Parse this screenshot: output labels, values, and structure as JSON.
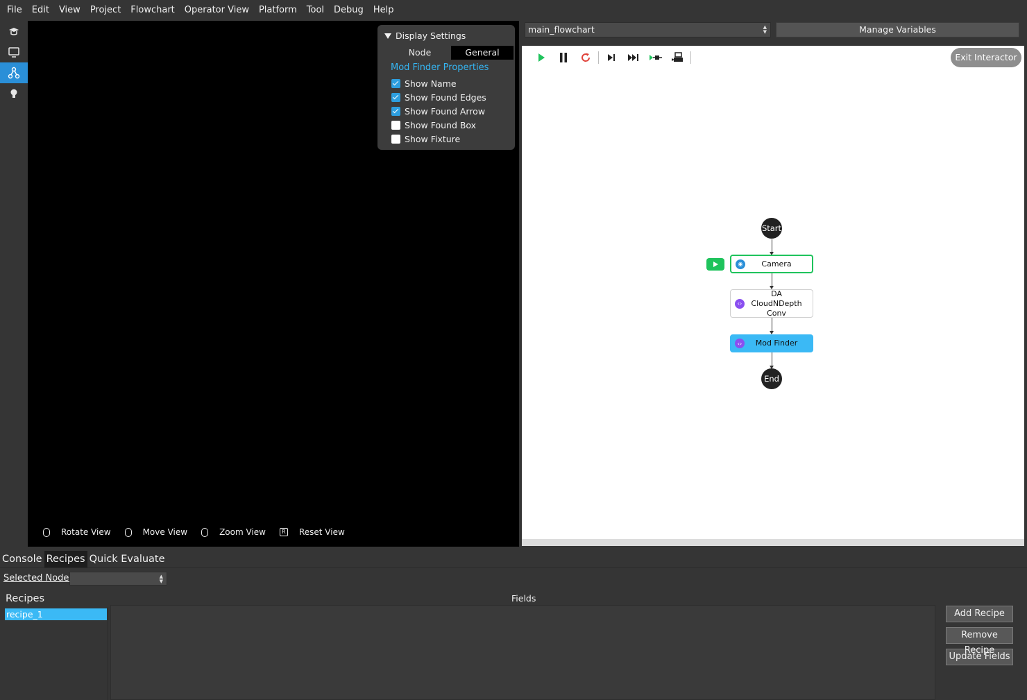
{
  "menu": [
    "File",
    "Edit",
    "View",
    "Project",
    "Flowchart",
    "Operator View",
    "Platform",
    "Tool",
    "Debug",
    "Help"
  ],
  "sidebar": {
    "items": [
      {
        "icon": "graduation-cap-icon"
      },
      {
        "icon": "monitor-icon"
      },
      {
        "icon": "flowchart-icon",
        "active": true
      },
      {
        "icon": "lightbulb-icon"
      }
    ]
  },
  "display_settings": {
    "title": "Display Settings",
    "tabs": [
      "Node",
      "General"
    ],
    "active_tab": "General",
    "section": "Mod Finder Properties",
    "options": [
      {
        "label": "Show Name",
        "checked": true
      },
      {
        "label": "Show Found Edges",
        "checked": true
      },
      {
        "label": "Show Found Arrow",
        "checked": true
      },
      {
        "label": "Show Found Box",
        "checked": false
      },
      {
        "label": "Show Fixture",
        "checked": false
      }
    ]
  },
  "view_hints": [
    "Rotate View",
    "Move View",
    "Zoom View",
    "Reset View"
  ],
  "reset_key": "R",
  "flowchart": {
    "selected": "main_flowchart",
    "manage_label": "Manage Variables",
    "exit_label": "Exit Interactor",
    "nodes": {
      "start": "Start",
      "camera": "Camera",
      "conv": "DA CloudNDepth Conv",
      "modfinder": "Mod Finder",
      "end": "End"
    }
  },
  "bottom": {
    "tabs": [
      "Console",
      "Recipes",
      "Quick Evaluate"
    ],
    "active_tab": "Recipes",
    "selected_node_label": "Selected Node:",
    "selected_node_value": "",
    "recipes_title": "Recipes",
    "fields_title": "Fields",
    "recipes": [
      "recipe_1"
    ],
    "buttons": [
      "Add Recipe",
      "Remove Recipe",
      "Update Fields"
    ]
  },
  "colors": {
    "accent": "#2a8fd8",
    "highlight": "#3bb9f5",
    "run_green": "#1fc35c",
    "restart_red": "#e0433b"
  }
}
